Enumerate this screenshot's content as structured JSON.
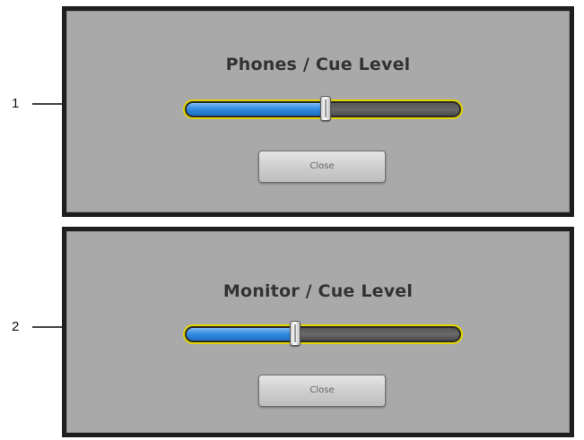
{
  "callouts": [
    {
      "number": "1"
    },
    {
      "number": "2"
    }
  ],
  "dialogs": [
    {
      "title": "Phones / Cue Level",
      "slider": {
        "level_fraction": 0.51,
        "fill_color": "#2f8ae0",
        "outline_color": "#e2d400"
      },
      "close_label": "Close"
    },
    {
      "title": "Monitor / Cue Level",
      "slider": {
        "level_fraction": 0.4,
        "fill_color": "#2f8ae0",
        "outline_color": "#e2d400"
      },
      "close_label": "Close"
    }
  ],
  "icons": {
    "callout_arrow": "right-arrow-icon"
  }
}
